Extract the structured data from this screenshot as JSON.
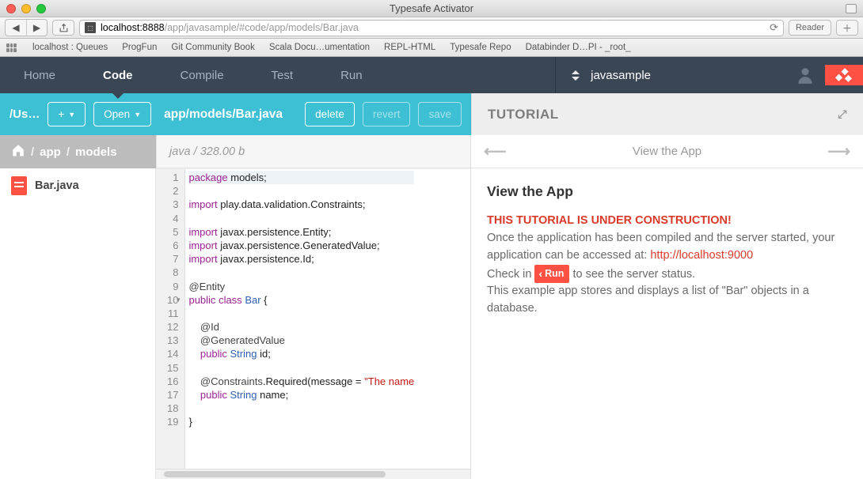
{
  "window": {
    "title": "Typesafe Activator"
  },
  "browser": {
    "host": "localhost:8888",
    "path": "/app/javasample/#code/app/models/Bar.java",
    "reader_label": "Reader"
  },
  "bookmarks": [
    "localhost : Queues",
    "ProgFun",
    "Git Community Book",
    "Scala Docu…umentation",
    "REPL-HTML",
    "Typesafe Repo",
    "Databinder D…PI - _root_"
  ],
  "nav": {
    "tabs": [
      "Home",
      "Code",
      "Compile",
      "Test",
      "Run"
    ],
    "active": "Code",
    "project": "javasample"
  },
  "actionbar": {
    "path_root": "/Us…",
    "add_label": "+",
    "open_label": "Open",
    "file_path": "app/models/Bar.java",
    "delete": "delete",
    "revert": "revert",
    "save": "save"
  },
  "breadcrumb": {
    "segments": [
      "app",
      "models"
    ]
  },
  "code_info": {
    "lang": "java",
    "size": "328.00 b"
  },
  "tree": {
    "items": [
      {
        "name": "Bar.java"
      }
    ]
  },
  "editor": {
    "lines": [
      {
        "n": 1,
        "tokens": [
          [
            "kw",
            "package"
          ],
          [
            "",
            " models;"
          ]
        ],
        "active": true
      },
      {
        "n": 2,
        "tokens": []
      },
      {
        "n": 3,
        "tokens": [
          [
            "kw",
            "import"
          ],
          [
            "",
            " play.data.validation.Constraints;"
          ]
        ]
      },
      {
        "n": 4,
        "tokens": []
      },
      {
        "n": 5,
        "tokens": [
          [
            "kw",
            "import"
          ],
          [
            "",
            " javax.persistence.Entity;"
          ]
        ]
      },
      {
        "n": 6,
        "tokens": [
          [
            "kw",
            "import"
          ],
          [
            "",
            " javax.persistence.GeneratedValue;"
          ]
        ]
      },
      {
        "n": 7,
        "tokens": [
          [
            "kw",
            "import"
          ],
          [
            "",
            " javax.persistence.Id;"
          ]
        ]
      },
      {
        "n": 8,
        "tokens": []
      },
      {
        "n": 9,
        "tokens": [
          [
            "ann",
            "@Entity"
          ]
        ]
      },
      {
        "n": 10,
        "tokens": [
          [
            "kw",
            "public"
          ],
          [
            "",
            " "
          ],
          [
            "kw",
            "class"
          ],
          [
            "",
            " "
          ],
          [
            "cls",
            "Bar"
          ],
          [
            "",
            " {"
          ]
        ],
        "fold": true
      },
      {
        "n": 11,
        "tokens": []
      },
      {
        "n": 12,
        "tokens": [
          [
            "",
            "    "
          ],
          [
            "ann",
            "@Id"
          ]
        ]
      },
      {
        "n": 13,
        "tokens": [
          [
            "",
            "    "
          ],
          [
            "ann",
            "@GeneratedValue"
          ]
        ]
      },
      {
        "n": 14,
        "tokens": [
          [
            "",
            "    "
          ],
          [
            "kw",
            "public"
          ],
          [
            "",
            " "
          ],
          [
            "cls",
            "String"
          ],
          [
            "",
            " id;"
          ]
        ]
      },
      {
        "n": 15,
        "tokens": []
      },
      {
        "n": 16,
        "tokens": [
          [
            "",
            "    "
          ],
          [
            "ann",
            "@Constraints"
          ],
          [
            "",
            ".Required(message = "
          ],
          [
            "str",
            "\"The name"
          ]
        ]
      },
      {
        "n": 17,
        "tokens": [
          [
            "",
            "    "
          ],
          [
            "kw",
            "public"
          ],
          [
            "",
            " "
          ],
          [
            "cls",
            "String"
          ],
          [
            "",
            " name;"
          ]
        ]
      },
      {
        "n": 18,
        "tokens": []
      },
      {
        "n": 19,
        "tokens": [
          [
            "",
            "}"
          ]
        ]
      }
    ]
  },
  "tutorial": {
    "header": "TUTORIAL",
    "nav_title": "View the App",
    "title": "View the App",
    "warning": "THIS TUTORIAL IS UNDER CONSTRUCTION!",
    "p1a": "Once the application has been compiled and the server started, your application can be accessed at: ",
    "link": "http://localhost:9000",
    "p2a": "Check in ",
    "run_label": "Run",
    "p2b": " to see the server status.",
    "p3": "This example app stores and displays a list of \"Bar\" objects in a database."
  }
}
